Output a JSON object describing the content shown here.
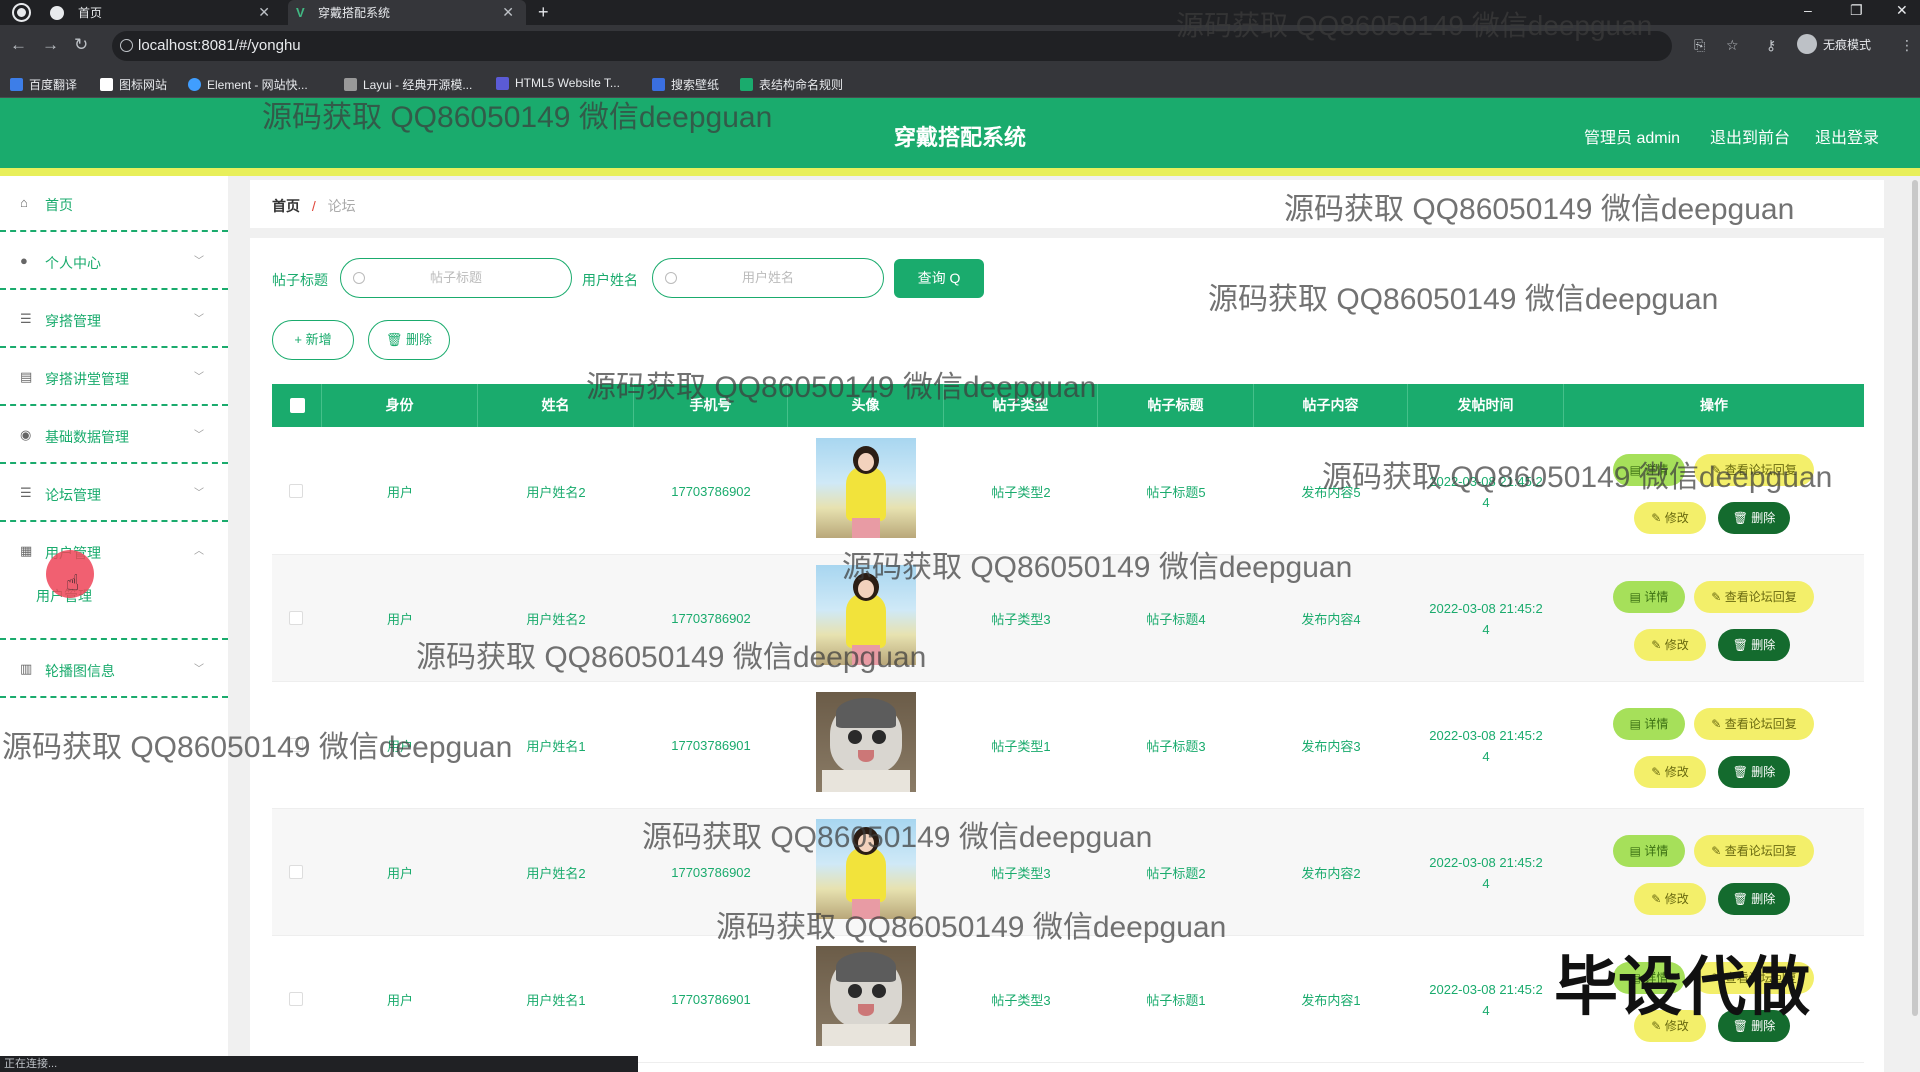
{
  "browser": {
    "tabs": [
      {
        "title": "首页",
        "active": false
      },
      {
        "title": "穿戴搭配系统",
        "active": true
      }
    ],
    "url": "localhost:8081/#/yonghu",
    "incognito_label": "无痕模式",
    "bookmarks": [
      "百度翻译",
      "图标网站",
      "Element - 网站快...",
      "Layui - 经典开源模...",
      "HTML5 Website T...",
      "搜索壁纸",
      "表结构命名规则"
    ],
    "status_text": "正在连接..."
  },
  "header": {
    "title": "穿戴搭配系统",
    "user_label": "管理员 admin",
    "front_link": "退出到前台",
    "logout_link": "退出登录",
    "brand_color": "#1aab6d",
    "strip_color": "#e8ef5a"
  },
  "sidebar": {
    "items": [
      {
        "label": "首页",
        "icon": "home-icon"
      },
      {
        "label": "个人中心",
        "icon": "user-icon"
      },
      {
        "label": "穿搭管理",
        "icon": "list-icon"
      },
      {
        "label": "穿搭讲堂管理",
        "icon": "chat-icon"
      },
      {
        "label": "基础数据管理",
        "icon": "pin-icon"
      },
      {
        "label": "论坛管理",
        "icon": "list-icon"
      },
      {
        "label": "用户管理",
        "icon": "grid-icon",
        "expanded": true
      },
      {
        "label": "轮播图信息",
        "icon": "bank-icon"
      }
    ],
    "sub_item": "用户管理"
  },
  "breadcrumb": {
    "home": "首页",
    "separator": "/",
    "current": "论坛"
  },
  "search": {
    "title_label": "帖子标题",
    "title_placeholder": "帖子标题",
    "name_label": "用户姓名",
    "name_placeholder": "用户姓名",
    "query_button": "查询 Q"
  },
  "actions": {
    "add": "+ 新增",
    "delete": "删除"
  },
  "table": {
    "columns": [
      "身份",
      "姓名",
      "手机号",
      "头像",
      "帖子类型",
      "帖子标题",
      "帖子内容",
      "发帖时间",
      "操作"
    ],
    "rows": [
      {
        "role": "用户",
        "name": "用户姓名2",
        "phone": "17703786902",
        "avatar": "girl",
        "type": "帖子类型2",
        "title": "帖子标题5",
        "content": "发布内容5",
        "time": "2022-03-08 21:45:2",
        "time2": "4"
      },
      {
        "role": "用户",
        "name": "用户姓名2",
        "phone": "17703786902",
        "avatar": "girl",
        "type": "帖子类型3",
        "title": "帖子标题4",
        "content": "发布内容4",
        "time": "2022-03-08 21:45:2",
        "time2": "4"
      },
      {
        "role": "用户",
        "name": "用户姓名1",
        "phone": "17703786901",
        "avatar": "cat",
        "type": "帖子类型1",
        "title": "帖子标题3",
        "content": "发布内容3",
        "time": "2022-03-08 21:45:2",
        "time2": "4"
      },
      {
        "role": "用户",
        "name": "用户姓名2",
        "phone": "17703786902",
        "avatar": "girl",
        "type": "帖子类型3",
        "title": "帖子标题2",
        "content": "发布内容2",
        "time": "2022-03-08 21:45:2",
        "time2": "4"
      },
      {
        "role": "用户",
        "name": "用户姓名1",
        "phone": "17703786901",
        "avatar": "cat",
        "type": "帖子类型3",
        "title": "帖子标题1",
        "content": "发布内容1",
        "time": "2022-03-08 21:45:2",
        "time2": "4"
      }
    ],
    "ops": {
      "detail": "详情",
      "reply": "查看论坛回复",
      "edit": "修改",
      "delete": "删除"
    }
  },
  "overlay": {
    "watermark": "源码获取 QQ86050149 微信deepguan",
    "promo": "毕设代做"
  }
}
